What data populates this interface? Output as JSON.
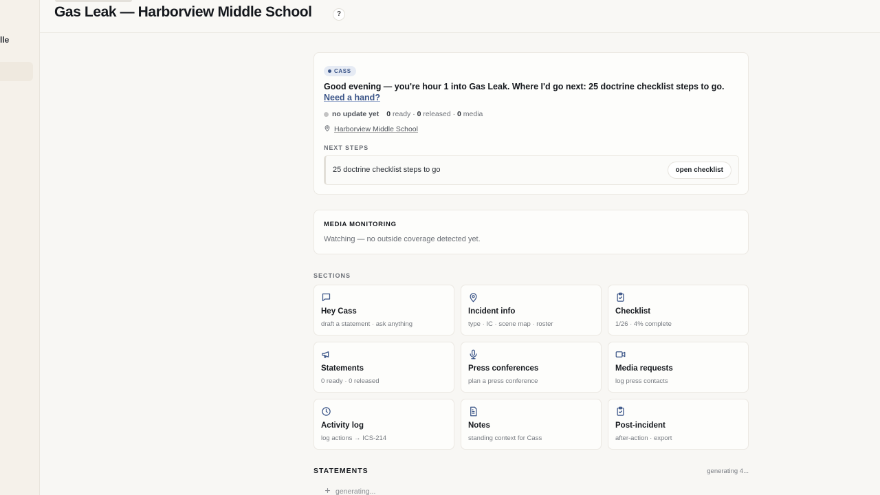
{
  "sidebar": {
    "visible_label": "lle"
  },
  "header": {
    "title": "Gas Leak — Harborview Middle School",
    "help_label": "?"
  },
  "cass": {
    "badge": "CASS",
    "greeting": "Good evening — you're hour 1 into Gas Leak. Where I'd go next: 25 doctrine checklist steps to go.",
    "help_link": "Need a hand?",
    "update_status": "no update yet",
    "ready_count": "0",
    "ready_label": "ready ·",
    "released_count": "0",
    "released_label": "released ·",
    "media_count": "0",
    "media_label": "media",
    "location": "Harborview Middle School",
    "next_steps_label": "NEXT STEPS",
    "next_step": "25 doctrine checklist steps to go",
    "next_step_action": "open checklist"
  },
  "media_monitoring": {
    "title": "MEDIA MONITORING",
    "text": "Watching — no outside coverage detected yet."
  },
  "sections_label": "SECTIONS",
  "sections": [
    {
      "title": "Hey Cass",
      "subtitle": "draft a statement · ask anything",
      "icon": "chat-icon"
    },
    {
      "title": "Incident info",
      "subtitle": "type · IC · scene map · roster",
      "icon": "map-pin-icon"
    },
    {
      "title": "Checklist",
      "subtitle": "1/26 · 4% complete",
      "icon": "clipboard-check-icon"
    },
    {
      "title": "Statements",
      "subtitle": "0 ready · 0 released",
      "icon": "megaphone-icon"
    },
    {
      "title": "Press conferences",
      "subtitle": "plan a press conference",
      "icon": "microphone-icon"
    },
    {
      "title": "Media requests",
      "subtitle": "log press contacts",
      "icon": "video-camera-icon"
    },
    {
      "title": "Activity log",
      "subtitle": "log actions → ICS-214",
      "icon": "clock-icon"
    },
    {
      "title": "Notes",
      "subtitle": "standing context for Cass",
      "icon": "document-icon"
    },
    {
      "title": "Post-incident",
      "subtitle": "after-action · export",
      "icon": "clipboard-check-icon"
    }
  ],
  "statements": {
    "title": "STATEMENTS",
    "status": "generating 4...",
    "generating_item": "generating..."
  },
  "colors": {
    "accent": "#3a5487",
    "icon": "#3a5487",
    "background": "#f8f7f4"
  }
}
